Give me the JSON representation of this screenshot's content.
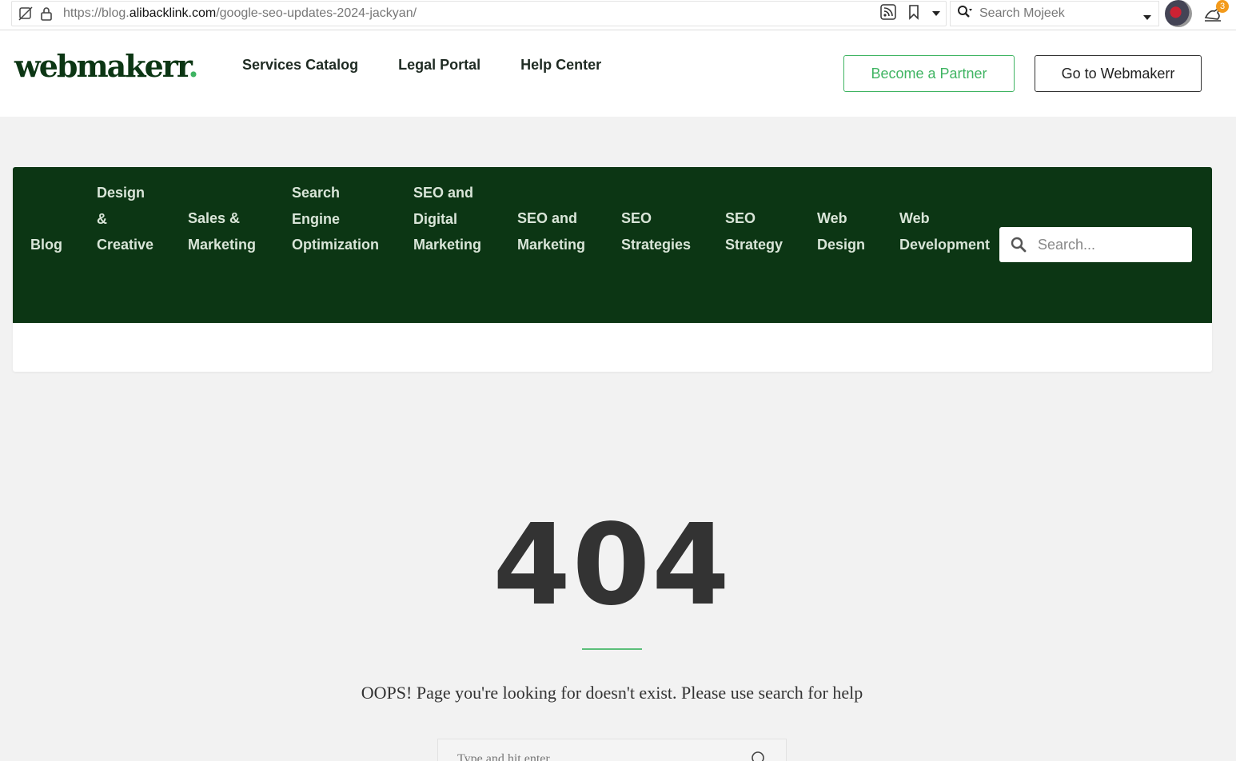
{
  "browser": {
    "url_prefix": "https://blog.",
    "url_domain": "alibacklink.com",
    "url_path": "/google-seo-updates-2024-jackyan/",
    "search_placeholder": "Search Mojeek",
    "extension_badge": "3",
    "icons": [
      "edit-off-icon",
      "lock-icon",
      "rss-icon",
      "bookmark-icon",
      "dropdown-icon",
      "search-icon",
      "avatar",
      "extension-icon"
    ]
  },
  "header": {
    "logo_text": "webmakerr",
    "logo_dot": ".",
    "nav": [
      "Services Catalog",
      "Legal Portal",
      "Help Center"
    ],
    "partner_button": "Become a Partner",
    "go_button": "Go to Webmakerr"
  },
  "categories": [
    {
      "lines": [
        "Blog"
      ]
    },
    {
      "lines": [
        "Design",
        "&",
        "Creative"
      ]
    },
    {
      "lines": [
        "Sales &",
        "Marketing"
      ]
    },
    {
      "lines": [
        "Search",
        "Engine",
        "Optimization"
      ]
    },
    {
      "lines": [
        "SEO and",
        "Digital",
        "Marketing"
      ]
    },
    {
      "lines": [
        "SEO and",
        "Marketing"
      ]
    },
    {
      "lines": [
        "SEO",
        "Strategies"
      ]
    },
    {
      "lines": [
        "SEO",
        "Strategy"
      ]
    },
    {
      "lines": [
        "Web",
        "Design"
      ]
    },
    {
      "lines": [
        "Web",
        "Development"
      ]
    }
  ],
  "category_search_placeholder": "Search...",
  "error": {
    "code": "404",
    "message": "OOPS! Page you're looking for doesn't exist. Please use search for help",
    "search_placeholder": "Type and hit enter"
  },
  "colors": {
    "brand_green": "#0c3614",
    "accent_green": "#3fb462",
    "page_bg": "#f2f2f2"
  }
}
